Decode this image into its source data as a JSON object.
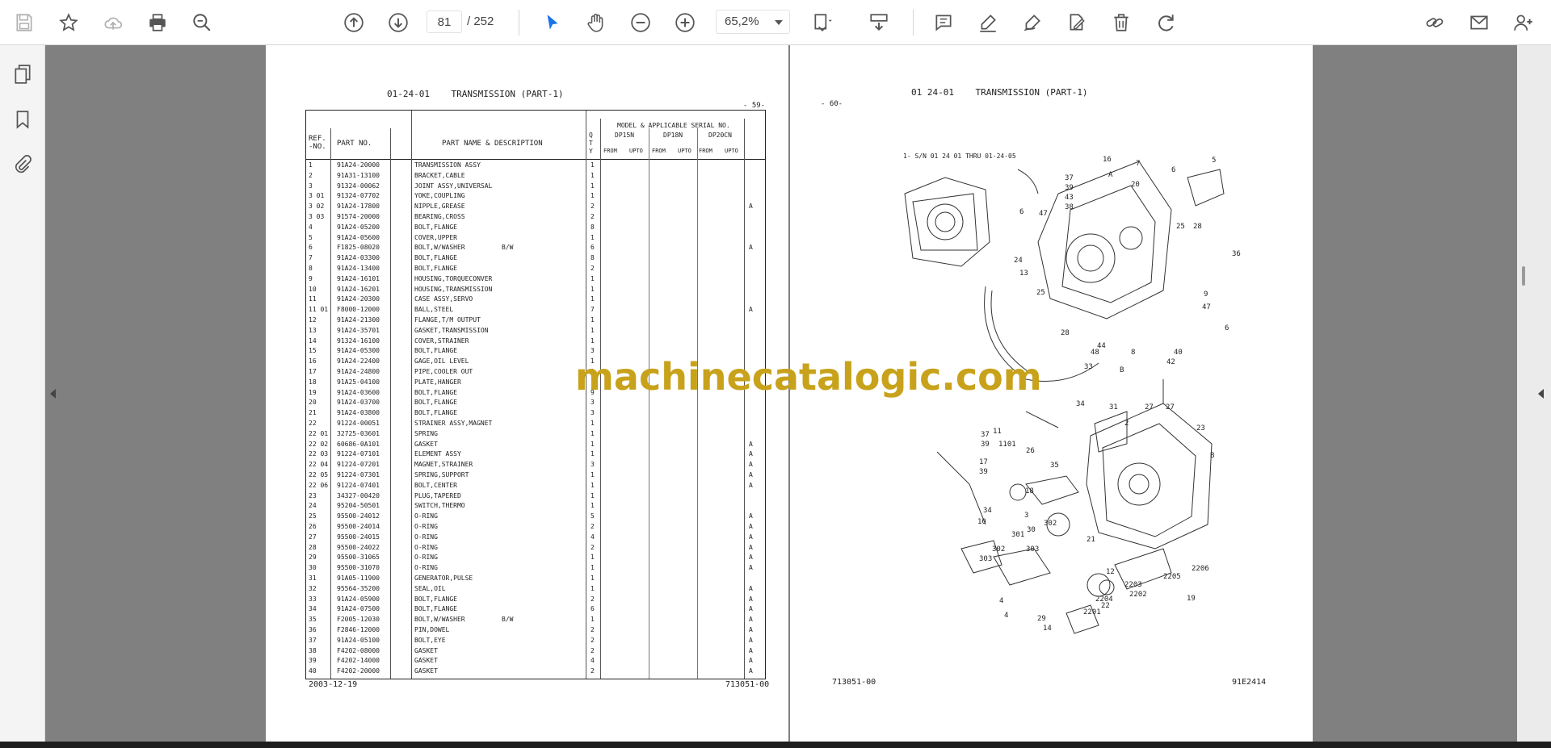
{
  "toolbar": {
    "page_current": "81",
    "page_separator": "/",
    "page_total": "252",
    "zoom": "65,2%",
    "icons": [
      "save-icon",
      "star-icon",
      "cloud-upload-icon",
      "print-icon",
      "zoom-search-icon",
      "page-up-icon",
      "page-down-icon",
      "zoom-out-icon",
      "zoom-in-icon",
      "select-cursor-icon",
      "hand-icon",
      "fit-page-icon",
      "scroll-mode-icon",
      "comment-icon",
      "highlight-pen-icon",
      "draw-icon",
      "edit-sign-icon",
      "trash-icon",
      "redo-icon",
      "share-link-icon",
      "email-icon",
      "add-user-icon"
    ]
  },
  "left_panel": {
    "icons": [
      "pages-icon",
      "bookmark-icon",
      "attachment-icon"
    ]
  },
  "watermark": "machinecatalogic.com",
  "left_page": {
    "heading_code": "01-24-01",
    "heading_title": "TRANSMISSION (PART-1)",
    "page_number": "- 59-",
    "header": {
      "ref_no": "REF.\n-NO.",
      "part_no": "PART NO.",
      "part_name": "PART NAME & DESCRIPTION",
      "qty": "Q\nT\nY",
      "model_serial": "MODEL & APPLICABLE SERIAL NO.",
      "models": [
        "DP15N",
        "DP18N",
        "DP20CN"
      ],
      "from": "FROM",
      "upto": "UPTO"
    },
    "rows": [
      {
        "ref": "1",
        "part": "91A24-20000",
        "name": "TRANSMISSION ASSY",
        "qty": "1",
        "note": ""
      },
      {
        "ref": "2",
        "part": "91A31-13100",
        "name": "BRACKET,CABLE",
        "qty": "1",
        "note": ""
      },
      {
        "ref": "3",
        "part": "91324-00062",
        "name": "JOINT ASSY,UNIVERSAL",
        "qty": "1",
        "note": ""
      },
      {
        "ref": "3 01",
        "part": "91324-07702",
        "name": "YOKE,COUPLING",
        "qty": "1",
        "note": ""
      },
      {
        "ref": "3 02",
        "part": "91A24-17800",
        "name": "NIPPLE,GREASE",
        "qty": "2",
        "note": "A"
      },
      {
        "ref": "3 03",
        "part": "91574-20000",
        "name": "BEARING,CROSS",
        "qty": "2",
        "note": ""
      },
      {
        "ref": "4",
        "part": "91A24-05200",
        "name": "BOLT,FLANGE",
        "qty": "8",
        "note": ""
      },
      {
        "ref": "5",
        "part": "91A24-05600",
        "name": "COVER,UPPER",
        "qty": "1",
        "note": ""
      },
      {
        "ref": "6",
        "part": "F1825-08020",
        "name": "BOLT,W/WASHER",
        "qty": "6",
        "note": "A"
      },
      {
        "ref": "7",
        "part": "91A24-03300",
        "name": "BOLT,FLANGE",
        "qty": "8",
        "note": ""
      },
      {
        "ref": "8",
        "part": "91A24-13400",
        "name": "BOLT,FLANGE",
        "qty": "2",
        "note": ""
      },
      {
        "ref": "9",
        "part": "91A24-16101",
        "name": "HOUSING,TORQUECONVER",
        "qty": "1",
        "note": ""
      },
      {
        "ref": "10",
        "part": "91A24-16201",
        "name": "HOUSING,TRANSMISSION",
        "qty": "1",
        "note": ""
      },
      {
        "ref": "11",
        "part": "91A24-20300",
        "name": "CASE ASSY,SERVO",
        "qty": "1",
        "note": ""
      },
      {
        "ref": "11 01",
        "part": "F8000-12000",
        "name": "BALL,STEEL",
        "qty": "7",
        "note": "A"
      },
      {
        "ref": "12",
        "part": "91A24-21300",
        "name": "FLANGE,T/M OUTPUT",
        "qty": "1",
        "note": ""
      },
      {
        "ref": "13",
        "part": "91A24-35701",
        "name": "GASKET,TRANSMISSION",
        "qty": "1",
        "note": ""
      },
      {
        "ref": "14",
        "part": "91324-16100",
        "name": "COVER,STRAINER",
        "qty": "1",
        "note": ""
      },
      {
        "ref": "15",
        "part": "91A24-05300",
        "name": "BOLT,FLANGE",
        "qty": "3",
        "note": ""
      },
      {
        "ref": "16",
        "part": "91A24-22400",
        "name": "GAGE,OIL LEVEL",
        "qty": "1",
        "note": ""
      },
      {
        "ref": "17",
        "part": "91A24-24800",
        "name": "PIPE,COOLER OUT",
        "qty": "1",
        "note": ""
      },
      {
        "ref": "18",
        "part": "91A25-04100",
        "name": "PLATE,HANGER",
        "qty": "1",
        "note": ""
      },
      {
        "ref": "19",
        "part": "91A24-03600",
        "name": "BOLT,FLANGE",
        "qty": "9",
        "note": ""
      },
      {
        "ref": "20",
        "part": "91A24-03700",
        "name": "BOLT,FLANGE",
        "qty": "3",
        "note": ""
      },
      {
        "ref": "21",
        "part": "91A24-03800",
        "name": "BOLT,FLANGE",
        "qty": "3",
        "note": ""
      },
      {
        "ref": "22",
        "part": "91224-00051",
        "name": "STRAINER ASSY,MAGNET",
        "qty": "1",
        "note": ""
      },
      {
        "ref": "22 01",
        "part": "32725-03601",
        "name": "SPRING",
        "qty": "1",
        "note": ""
      },
      {
        "ref": "22 02",
        "part": "60686-0A101",
        "name": "GASKET",
        "qty": "1",
        "note": "A"
      },
      {
        "ref": "22 03",
        "part": "91224-07101",
        "name": "ELEMENT ASSY",
        "qty": "1",
        "note": "A"
      },
      {
        "ref": "22 04",
        "part": "91224-07201",
        "name": "MAGNET,STRAINER",
        "qty": "3",
        "note": "A"
      },
      {
        "ref": "22 05",
        "part": "91224-07301",
        "name": "SPRING,SUPPORT",
        "qty": "1",
        "note": "A"
      },
      {
        "ref": "22 06",
        "part": "91224-07401",
        "name": "BOLT,CENTER",
        "qty": "1",
        "note": "A"
      },
      {
        "ref": "23",
        "part": "34327-00420",
        "name": "PLUG,TAPERED",
        "qty": "1",
        "note": ""
      },
      {
        "ref": "24",
        "part": "95204-50501",
        "name": "SWITCH,THERMO",
        "qty": "1",
        "note": ""
      },
      {
        "ref": "25",
        "part": "95500-24012",
        "name": "O-RING",
        "qty": "5",
        "note": "A"
      },
      {
        "ref": "26",
        "part": "95500-24014",
        "name": "O-RING",
        "qty": "2",
        "note": "A"
      },
      {
        "ref": "27",
        "part": "95500-24015",
        "name": "O-RING",
        "qty": "4",
        "note": "A"
      },
      {
        "ref": "28",
        "part": "95500-24022",
        "name": "O-RING",
        "qty": "2",
        "note": "A"
      },
      {
        "ref": "29",
        "part": "95500-31065",
        "name": "O-RING",
        "qty": "1",
        "note": "A"
      },
      {
        "ref": "30",
        "part": "95500-31070",
        "name": "O-RING",
        "qty": "1",
        "note": "A"
      },
      {
        "ref": "31",
        "part": "91A05-11900",
        "name": "GENERATOR,PULSE",
        "qty": "1",
        "note": ""
      },
      {
        "ref": "32",
        "part": "95564-35200",
        "name": "SEAL,OIL",
        "qty": "1",
        "note": "A"
      },
      {
        "ref": "33",
        "part": "91A24-05900",
        "name": "BOLT,FLANGE",
        "qty": "2",
        "note": "A"
      },
      {
        "ref": "34",
        "part": "91A24-07500",
        "name": "BOLT,FLANGE",
        "qty": "6",
        "note": "A"
      },
      {
        "ref": "35",
        "part": "F2005-12030",
        "name": "BOLT,W/WASHER",
        "qty": "1",
        "note": "A"
      },
      {
        "ref": "36",
        "part": "F2846-12000",
        "name": "PIN,DOWEL",
        "qty": "2",
        "note": "A"
      },
      {
        "ref": "37",
        "part": "91A24-05100",
        "name": "BOLT,EYE",
        "qty": "2",
        "note": "A"
      },
      {
        "ref": "38",
        "part": "F4202-08000",
        "name": "GASKET",
        "qty": "2",
        "note": "A"
      },
      {
        "ref": "39",
        "part": "F4202-14000",
        "name": "GASKET",
        "qty": "4",
        "note": "A"
      },
      {
        "ref": "40",
        "part": "F4202-20000",
        "name": "GASKET",
        "qty": "2",
        "note": "A"
      }
    ],
    "bw_note": "B/W",
    "footer_left": "2003-12-19",
    "footer_right": "713051-00"
  },
  "right_page": {
    "page_number": "- 60-",
    "heading_code": "01 24-01",
    "heading_title": "TRANSMISSION (PART-1)",
    "diagram_note": "1- S/N 01 24 01 THRU 01-24-05",
    "callouts": [
      "16",
      "37",
      "39",
      "43",
      "38",
      "7",
      "20",
      "6",
      "5",
      "47",
      "6",
      "A",
      "25",
      "28",
      "36",
      "24",
      "13",
      "25",
      "9",
      "47",
      "6",
      "28",
      "44",
      "48",
      "33",
      "8",
      "40",
      "42",
      "B",
      "34",
      "31",
      "27",
      "27",
      "2",
      "23",
      "37",
      "39",
      "11",
      "1101",
      "26",
      "35",
      "17",
      "39",
      "18",
      "B",
      "34",
      "10",
      "3",
      "30",
      "302",
      "301",
      "303",
      "302",
      "303",
      "21",
      "12",
      "4",
      "2206",
      "2205",
      "19",
      "2203",
      "2202",
      "2201",
      "22",
      "2204",
      "29",
      "14",
      "4"
    ],
    "footer_left": "713051-00",
    "footer_right": "91E2414"
  }
}
